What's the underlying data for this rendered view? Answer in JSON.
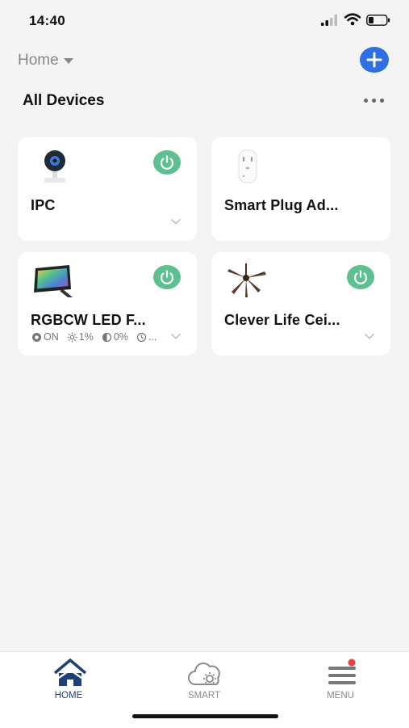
{
  "status_bar": {
    "time": "14:40",
    "signal_icon": "signal-icon",
    "wifi_icon": "wifi-icon",
    "battery_icon": "battery-icon"
  },
  "header": {
    "home_label": "Home",
    "add_icon": "plus-icon"
  },
  "section": {
    "title": "All Devices",
    "more_icon": "more-dots-icon"
  },
  "devices": [
    {
      "name": "IPC",
      "image": "camera-icon",
      "has_power": true,
      "power_on": true
    },
    {
      "name": "Smart Plug Ad...",
      "image": "smart-plug-icon",
      "has_power": false
    },
    {
      "name": "RGBCW LED F...",
      "image": "led-floodlight-icon",
      "has_power": true,
      "power_on": true,
      "stats": {
        "power": "ON",
        "brightness": "1%",
        "contrast": "0%",
        "timer": "..."
      }
    },
    {
      "name": "Clever Life Cei...",
      "image": "ceiling-fan-icon",
      "has_power": true,
      "power_on": true
    }
  ],
  "tabs": [
    {
      "label": "HOME",
      "icon": "home-icon",
      "active": true
    },
    {
      "label": "SMART",
      "icon": "smart-cloud-icon",
      "active": false
    },
    {
      "label": "MENU",
      "icon": "menu-icon",
      "active": false,
      "badge": true
    }
  ],
  "colors": {
    "accent": "#2f6fe4",
    "power_on": "#5dc08f",
    "active_tab": "#1f3f7a",
    "inactive_tab": "#8a8a8a",
    "badge": "#e54343"
  }
}
